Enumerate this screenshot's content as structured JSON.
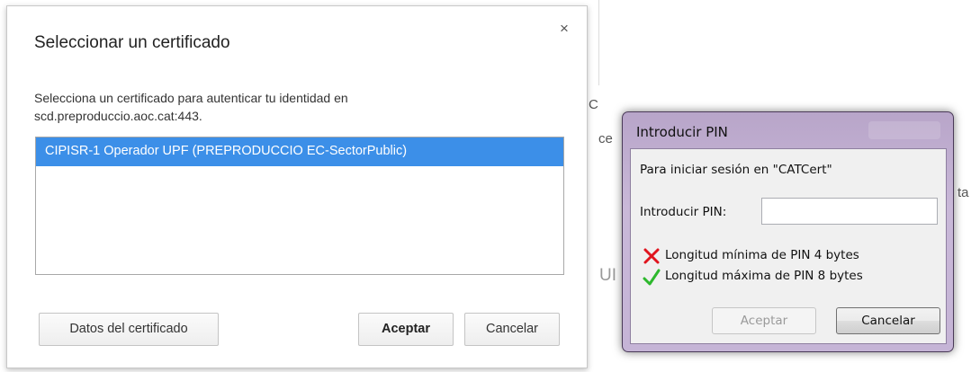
{
  "certificate_dialog": {
    "title": "Seleccionar un certificado",
    "close_glyph": "×",
    "description_line1": "Selecciona un certificado para autenticar tu identidad en",
    "description_line2": "scd.preproduccio.aoc.cat:443.",
    "certificates": [
      "CIPISR-1 Operador UPF (PREPRODUCCIO EC-SectorPublic)"
    ],
    "details_button": "Datos del certificado",
    "accept_button": "Aceptar",
    "cancel_button": "Cancelar"
  },
  "pin_dialog": {
    "title": "Introducir PIN",
    "session_text": "Para iniciar sesión en \"CATCert\"",
    "pin_label": "Introducir PIN:",
    "pin_value": "",
    "rules": [
      {
        "text": "Longitud mínima de PIN 4 bytes",
        "status": "fail",
        "icon": "red-x-icon",
        "color": "#e0141e"
      },
      {
        "text": "Longitud máxima de PIN 8 bytes",
        "status": "pass",
        "icon": "green-check-icon",
        "color": "#2db82d"
      }
    ],
    "accept_button": "Aceptar",
    "cancel_button": "Cancelar"
  },
  "background": {
    "fragments": [
      "C",
      "ce",
      "ta",
      "UI"
    ]
  },
  "colors": {
    "selection": "#3c8fe8",
    "pin_frame": "#c5b4d6"
  }
}
